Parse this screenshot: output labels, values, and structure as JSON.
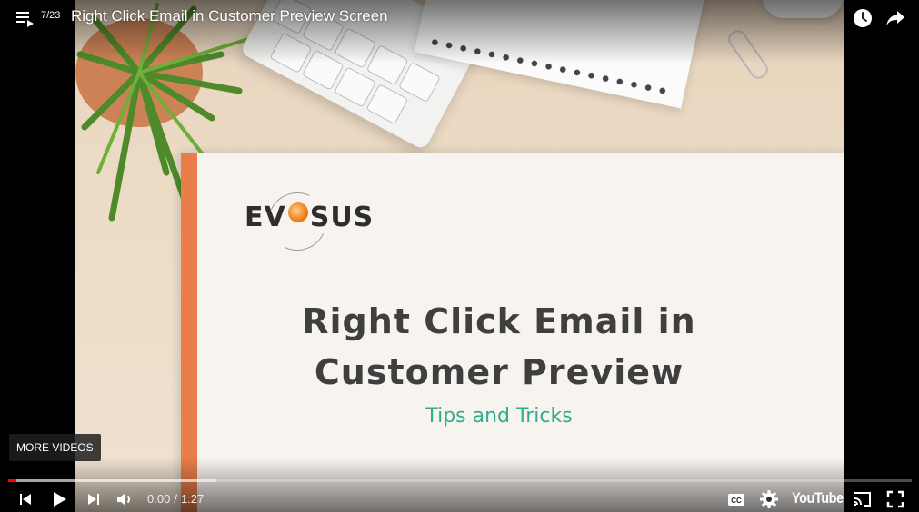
{
  "top_bar": {
    "playlist_count": "7/23",
    "video_title": "Right Click Email in Customer Preview Screen"
  },
  "slide": {
    "logo_text_left": "EV",
    "logo_text_right": "SUS",
    "title_line1": "Right Click Email in",
    "title_line2": "Customer Preview",
    "subtitle": "Tips and Tricks"
  },
  "overlay": {
    "more_videos_label": "MORE VIDEOS"
  },
  "controls": {
    "current_time": "0:00",
    "separator": "/",
    "duration": "1:27",
    "played_fraction": 0.0,
    "loaded_fraction": 0.23,
    "youtube_label": "YouTube"
  },
  "colors": {
    "progress_played": "#ff0000",
    "slide_accent": "#e97e4a",
    "subtitle_color": "#2fae8e",
    "logo_orb": "#ef7d1a"
  },
  "icons": [
    "playlist-icon",
    "watch-later-icon",
    "share-icon",
    "previous-icon",
    "play-icon",
    "next-icon",
    "volume-icon",
    "captions-icon",
    "settings-icon",
    "cast-icon",
    "fullscreen-icon"
  ]
}
